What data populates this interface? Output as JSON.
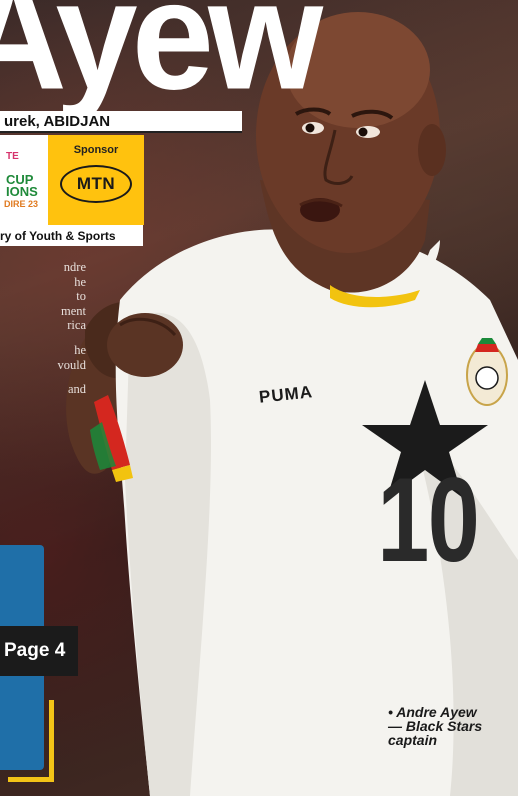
{
  "headline": "Ayew",
  "byline": "urek, ABIDJAN",
  "afcon": {
    "line1": "TE",
    "cup": "CUP",
    "ions": "IONS",
    "ivoire": "DIRE 23"
  },
  "sponsor": {
    "label": "Sponsor",
    "brand": "MTN"
  },
  "ministry": "ry of Youth & Sports",
  "body_lines": [
    "ndre",
    "he",
    "to",
    "ment",
    "rica",
    "",
    "he",
    "vould",
    "",
    "and"
  ],
  "page_tag": "Page 4",
  "jersey": {
    "brand": "PUMA",
    "number": "10"
  },
  "caption": {
    "line1": "• Andre Ayew",
    "line2": "— Black Stars",
    "line3": "captain"
  },
  "colors": {
    "sponsor_yellow": "#ffc20e",
    "panel_blue": "#1f6fa8",
    "frame_yellow": "#f3c417",
    "jersey_white": "#f4f3ef"
  }
}
